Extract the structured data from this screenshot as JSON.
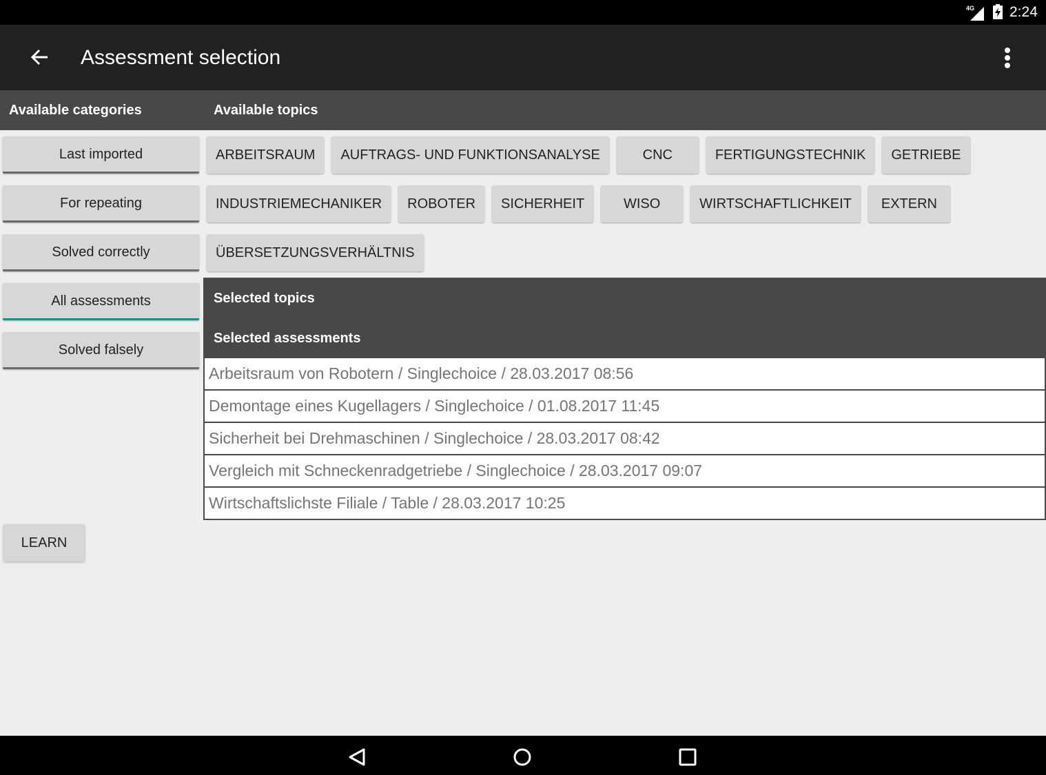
{
  "status_bar": {
    "network": "4G",
    "time": "2:24",
    "icons": [
      "signal-icon",
      "battery-charging-icon"
    ]
  },
  "app_bar": {
    "title": "Assessment selection",
    "back_icon": "arrow-back-icon",
    "menu_icon": "more-vert-icon"
  },
  "headers": {
    "categories": "Available categories",
    "topics": "Available topics"
  },
  "categories": [
    {
      "label": "Last imported",
      "active": false
    },
    {
      "label": "For repeating",
      "active": false
    },
    {
      "label": "Solved correctly",
      "active": false
    },
    {
      "label": "All assessments",
      "active": true
    },
    {
      "label": "Solved falsely",
      "active": false
    }
  ],
  "topics": {
    "rows": [
      [
        "ARBEITSRAUM",
        "AUFTRAGS- UND FUNKTIONSANALYSE",
        "CNC",
        "FERTIGUNGSTECHNIK",
        "GETRIEBE"
      ],
      [
        "INDUSTRIEMECHANIKER",
        "ROBOTER",
        "SICHERHEIT",
        "WISO",
        "WIRTSCHAFTLICHKEIT",
        "EXTERN"
      ],
      [
        "ÜBERSETZUNGSVERHÄLTNIS"
      ]
    ]
  },
  "selection": {
    "selected_topics_label": "Selected topics",
    "selected_assessments_label": "Selected assessments"
  },
  "assessments": [
    "Arbeitsraum von Robotern / Singlechoice / 28.03.2017 08:56",
    "Demontage eines Kugellagers / Singlechoice / 01.08.2017 11:45",
    "Sicherheit bei Drehmaschinen / Singlechoice / 28.03.2017 08:42",
    "Vergleich mit Schneckenradgetriebe / Singlechoice / 28.03.2017 09:07",
    "Wirtschaftslichste Filiale / Table / 28.03.2017 10:25"
  ],
  "learn_button": "LEARN",
  "colors": {
    "accent": "#009688",
    "app_bar": "#212121",
    "header_strip": "#484848",
    "button": "#d6d7d7"
  },
  "nav_bar": [
    "back-icon",
    "home-icon",
    "recents-icon"
  ]
}
